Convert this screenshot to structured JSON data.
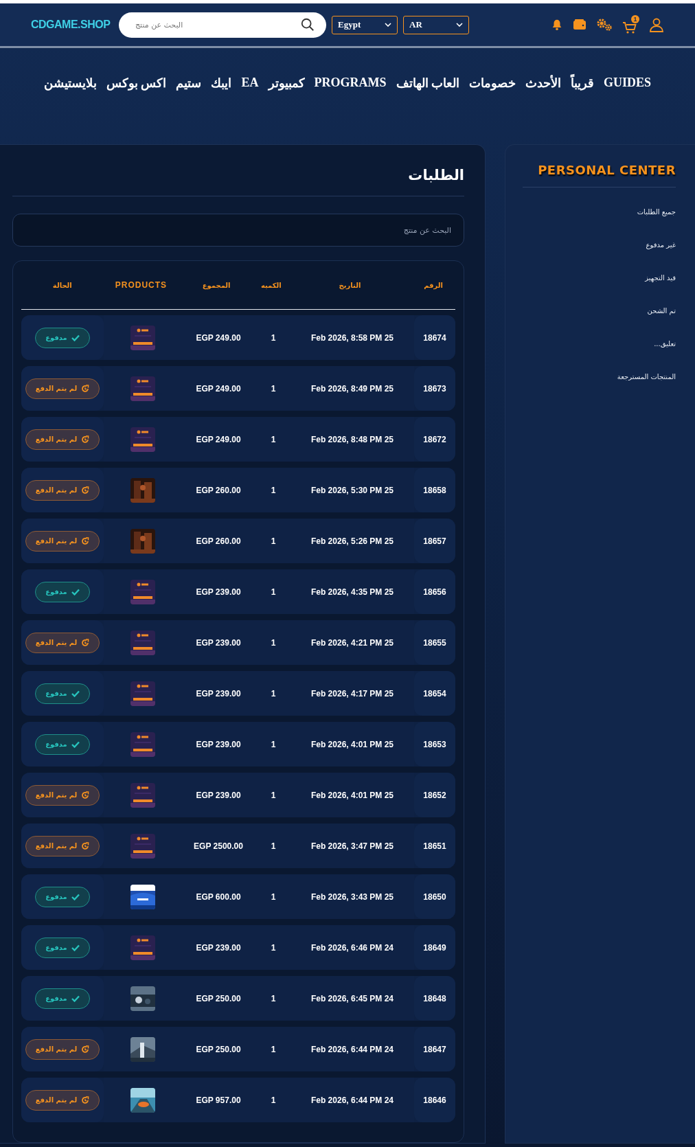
{
  "header": {
    "logo": "CDGAME.SHOP",
    "search": {
      "placeholder": "البحث عن منتج"
    },
    "country": "Egypt",
    "language": "AR",
    "cart_count": "1"
  },
  "nav": [
    "GUIDES",
    "قريباً",
    "الأحدث",
    "خصومات",
    "العاب الهاتف",
    "PROGRAMS",
    "كمبيوتر",
    "EA",
    "ايبك",
    "ستيم",
    "اكس بوكس",
    "بلايستيشن"
  ],
  "sidebar": {
    "title": "PERSONAL CENTER",
    "items": [
      "جميع الطلبات",
      "غير مدفوع",
      "قيد التجهيز",
      "تم الشحن",
      "تعليق...",
      "المنتجات المسترجعة"
    ]
  },
  "orders": {
    "title": "الطلبات",
    "search": {
      "placeholder": "البحث عن منتج"
    },
    "columns": [
      "الرقم",
      "التاريخ",
      "الكميه",
      "المجموع",
      "PRODUCTS",
      "الحالة"
    ],
    "rows": [
      {
        "number": "18674",
        "date": "Feb 2026, 8:58 PM 25",
        "quantity": "1",
        "total": "EGP 249.00",
        "status": {
          "kind": "paid",
          "label": "مدفوع"
        }
      },
      {
        "number": "18673",
        "date": "Feb 2026, 8:49 PM 25",
        "quantity": "1",
        "total": "EGP 249.00",
        "status": {
          "kind": "unpaid",
          "label": "لم يتم الدفع"
        }
      },
      {
        "number": "18672",
        "date": "Feb 2026, 8:48 PM 25",
        "quantity": "1",
        "total": "EGP 249.00",
        "status": {
          "kind": "unpaid",
          "label": "لم يتم الدفع"
        }
      },
      {
        "number": "18658",
        "date": "Feb 2026, 5:30 PM 25",
        "quantity": "1",
        "total": "EGP 260.00",
        "status": {
          "kind": "unpaid",
          "label": "لم يتم الدفع"
        }
      },
      {
        "number": "18657",
        "date": "Feb 2026, 5:26 PM 25",
        "quantity": "1",
        "total": "EGP 260.00",
        "status": {
          "kind": "unpaid",
          "label": "لم يتم الدفع"
        }
      },
      {
        "number": "18656",
        "date": "Feb 2026, 4:35 PM 25",
        "quantity": "1",
        "total": "EGP 239.00",
        "status": {
          "kind": "paid",
          "label": "مدفوع"
        }
      },
      {
        "number": "18655",
        "date": "Feb 2026, 4:21 PM 25",
        "quantity": "1",
        "total": "EGP 239.00",
        "status": {
          "kind": "unpaid",
          "label": "لم يتم الدفع"
        }
      },
      {
        "number": "18654",
        "date": "Feb 2026, 4:17 PM 25",
        "quantity": "1",
        "total": "EGP 239.00",
        "status": {
          "kind": "paid",
          "label": "مدفوع"
        }
      },
      {
        "number": "18653",
        "date": "Feb 2026, 4:01 PM 25",
        "quantity": "1",
        "total": "EGP 239.00",
        "status": {
          "kind": "paid",
          "label": "مدفوع"
        }
      },
      {
        "number": "18652",
        "date": "Feb 2026, 4:01 PM 25",
        "quantity": "1",
        "total": "EGP 239.00",
        "status": {
          "kind": "unpaid",
          "label": "لم يتم الدفع"
        }
      },
      {
        "number": "18651",
        "date": "Feb 2026, 3:47 PM 25",
        "quantity": "1",
        "total": "EGP 2500.00",
        "status": {
          "kind": "unpaid",
          "label": "لم يتم الدفع"
        }
      },
      {
        "number": "18650",
        "date": "Feb 2026, 3:43 PM 25",
        "quantity": "1",
        "total": "EGP 600.00",
        "status": {
          "kind": "paid",
          "label": "مدفوع"
        }
      },
      {
        "number": "18649",
        "date": "Feb 2026, 6:46 PM 24",
        "quantity": "1",
        "total": "EGP 239.00",
        "status": {
          "kind": "paid",
          "label": "مدفوع"
        }
      },
      {
        "number": "18648",
        "date": "Feb 2026, 6:45 PM 24",
        "quantity": "1",
        "total": "EGP 250.00",
        "status": {
          "kind": "paid",
          "label": "مدفوع"
        }
      },
      {
        "number": "18647",
        "date": "Feb 2026, 6:44 PM 24",
        "quantity": "1",
        "total": "EGP 250.00",
        "status": {
          "kind": "unpaid",
          "label": "لم يتم الدفع"
        }
      },
      {
        "number": "18646",
        "date": "Feb 2026, 6:44 PM 24",
        "quantity": "1",
        "total": "EGP 957.00",
        "status": {
          "kind": "unpaid",
          "label": "لم يتم الدفع"
        }
      }
    ]
  }
}
